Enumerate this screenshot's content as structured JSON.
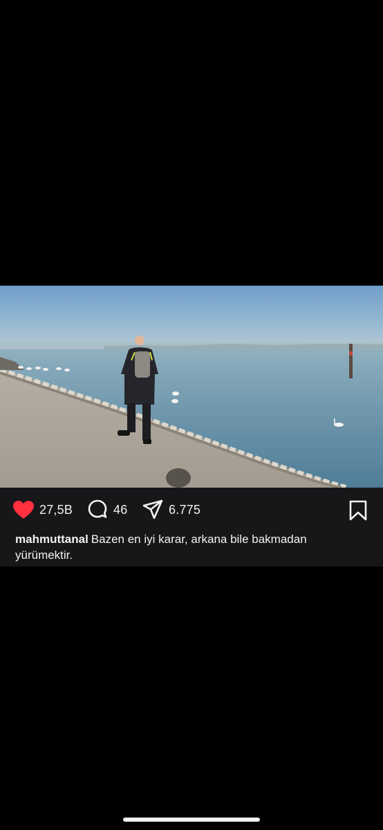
{
  "post": {
    "username": "mahmuttanal",
    "caption": "Bazen en iyi karar, arkana bile bakmadan yürümektir.",
    "likes": "27,5B",
    "comments": "46",
    "shares": "6.775",
    "liked": true
  },
  "icons": {
    "like": "heart-filled-icon",
    "comment": "speech-bubble-icon",
    "share": "paper-plane-icon",
    "save": "bookmark-icon"
  },
  "colors": {
    "background": "#000000",
    "panel": "#17171a",
    "like_red": "#ff3040",
    "text": "#f2f2f2"
  }
}
